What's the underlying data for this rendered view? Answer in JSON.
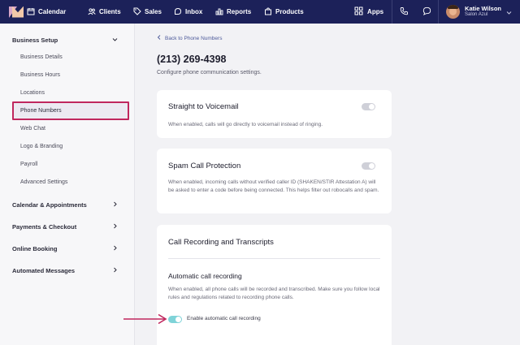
{
  "nav": {
    "items": [
      {
        "label": "Calendar",
        "icon": "calendar-icon"
      },
      {
        "label": "Clients",
        "icon": "clients-icon"
      },
      {
        "label": "Sales",
        "icon": "tag-icon"
      },
      {
        "label": "Inbox",
        "icon": "inbox-icon"
      },
      {
        "label": "Reports",
        "icon": "bar-chart-icon"
      },
      {
        "label": "Products",
        "icon": "bag-icon"
      }
    ],
    "apps_label": "Apps",
    "user": {
      "name": "Katie Wilson",
      "location": "Salon Azul"
    }
  },
  "sidebar": {
    "business_setup": "Business Setup",
    "sub_items": [
      "Business Details",
      "Business Hours",
      "Locations",
      "Phone Numbers",
      "Web Chat",
      "Logo & Branding",
      "Payroll",
      "Advanced Settings"
    ],
    "sections": [
      "Calendar & Appointments",
      "Payments & Checkout",
      "Online Booking",
      "Automated Messages"
    ]
  },
  "main": {
    "back_label": "Back to Phone Numbers",
    "title": "(213) 269-4398",
    "subtitle": "Configure phone communication settings.",
    "voicemail": {
      "title": "Straight to Voicemail",
      "desc": "When enabled, calls will go directly to voicemail instead of ringing.",
      "enabled": false
    },
    "spam": {
      "title": "Spam Call Protection",
      "desc": "When enabled, incoming calls without verified caller ID (SHAKEN/STIR Attestation A) will be asked to enter a code before being connected. This helps filter out robocalls and spam.",
      "enabled": false
    },
    "recording": {
      "title": "Call Recording and Transcripts",
      "sub_title": "Automatic call recording",
      "desc": "When enabled, all phone calls will be recorded and transcribed. Make sure you follow local rules and regulations related to recording phone calls.",
      "toggle_label": "Enable automatic call recording",
      "enabled": true
    }
  },
  "colors": {
    "nav_bg": "#1c2159",
    "highlight": "#c0275e",
    "toggle_on": "#7fd3d8"
  }
}
